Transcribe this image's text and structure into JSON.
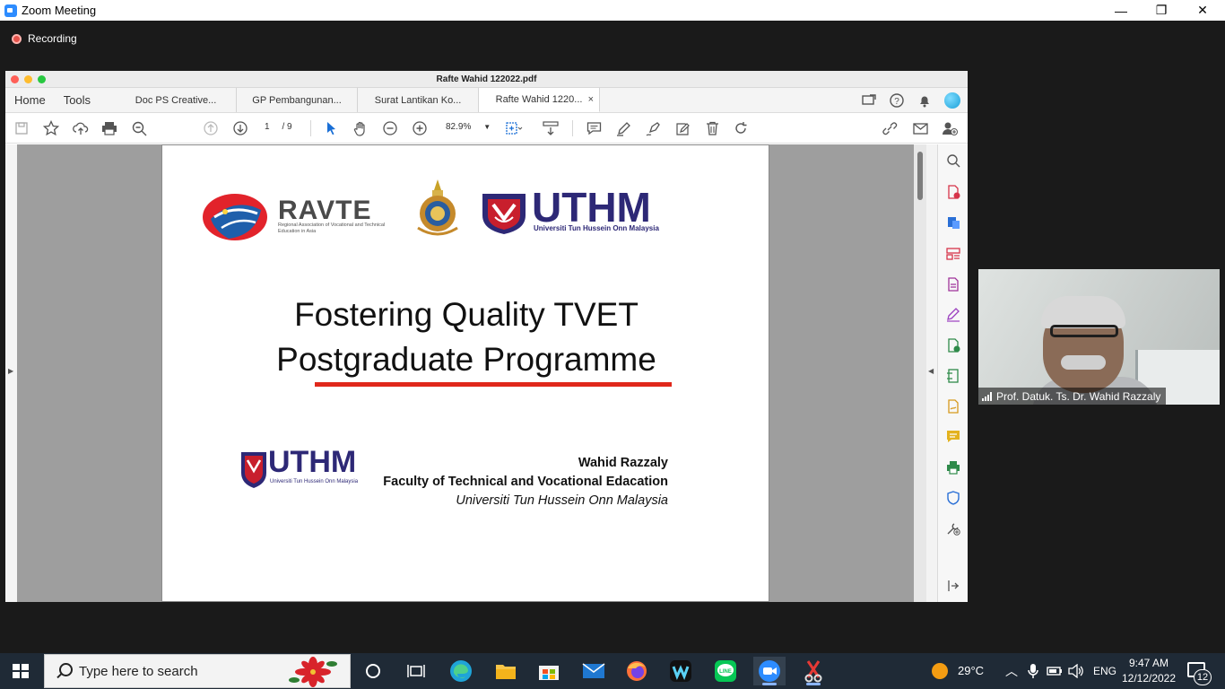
{
  "zoom": {
    "window_title": "Zoom Meeting",
    "minimize": "—",
    "restore": "❐",
    "close": "✕",
    "recording_label": "Recording"
  },
  "acrobat": {
    "file_title": "Rafte Wahid 122022.pdf",
    "home_label": "Home",
    "tools_label": "Tools",
    "tabs": [
      {
        "label": "Doc PS Creative..."
      },
      {
        "label": "GP Pembangunan..."
      },
      {
        "label": "Surat Lantikan Ko..."
      },
      {
        "label": "Rafte Wahid 1220..."
      }
    ],
    "tab_close": "×",
    "page_current": "1",
    "page_total": "/ 9",
    "zoom_level": "82.9%"
  },
  "slide": {
    "ravte_word": "RAVTE",
    "ravte_sub": "Regional Association of Vocational and Technical Education in Asia",
    "uthm_word": "UTHM",
    "uthm_sub": "Universiti Tun Hussein Onn Malaysia",
    "title_line1": "Fostering Quality TVET",
    "title_line2": "Postgraduate Programme",
    "uthm2_word": "UTHM",
    "uthm2_sub": "Universiti Tun Hussein Onn Malaysia",
    "author_name": "Wahid Razzaly",
    "author_faculty": "Faculty of Technical and Vocational Edacation",
    "author_university": "Universiti Tun Hussein Onn Malaysia",
    "accent_color": "#e0281b",
    "brand_color": "#2d2876"
  },
  "participant": {
    "name": "Prof. Datuk. Ts. Dr. Wahid Razzaly"
  },
  "taskbar": {
    "search_placeholder": "Type here to search",
    "temperature": "29°C",
    "language": "ENG",
    "time": "9:47 AM",
    "date": "12/12/2022",
    "notification_count": "12",
    "apps": [
      "task-view-icon",
      "edge-icon",
      "file-explorer-icon",
      "store-icon",
      "mail-icon",
      "firefox-icon",
      "webex-icon",
      "line-icon",
      "zoom-icon",
      "snipping-tool-icon"
    ]
  }
}
